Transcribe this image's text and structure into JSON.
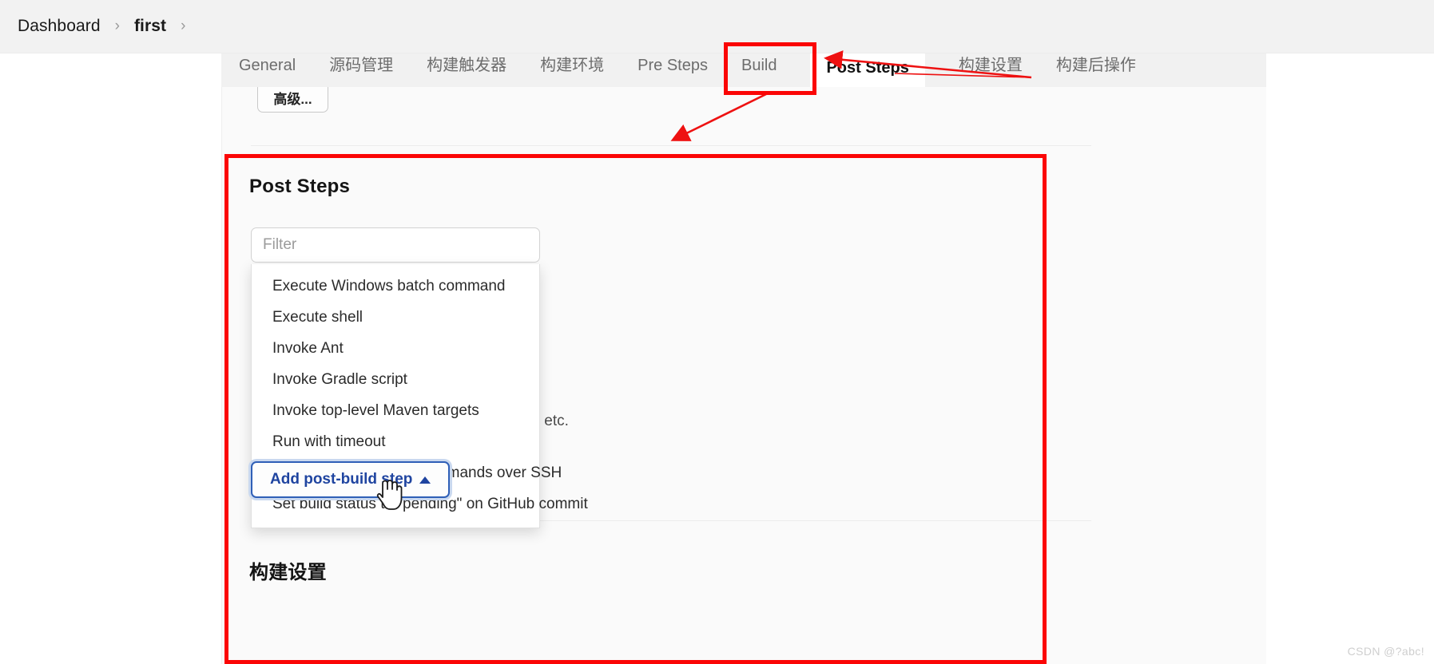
{
  "breadcrumb": {
    "items": [
      {
        "label": "Dashboard",
        "bold": false
      },
      {
        "label": "first",
        "bold": true
      }
    ],
    "separator": "›"
  },
  "tabs": [
    {
      "label": "General",
      "active": false
    },
    {
      "label": "源码管理",
      "active": false
    },
    {
      "label": "构建触发器",
      "active": false
    },
    {
      "label": "构建环境",
      "active": false
    },
    {
      "label": "Pre Steps",
      "active": false
    },
    {
      "label": "Build",
      "active": false
    },
    {
      "label": "Post Steps",
      "active": true
    },
    {
      "label": "构建设置",
      "active": false
    },
    {
      "label": "构建后操作",
      "active": false
    }
  ],
  "advanced_button": {
    "label": "高级..."
  },
  "post_steps": {
    "title": "Post Steps",
    "filter": {
      "placeholder": "Filter",
      "value": ""
    },
    "dropdown_items": [
      "Execute Windows batch command",
      "Execute shell",
      "Invoke Ant",
      "Invoke Gradle script",
      "Invoke top-level Maven targets",
      "Run with timeout",
      "Send files or execute commands over SSH",
      "Set build status to \"pending\" on GitHub commit"
    ],
    "background_description": "ul builds, etc.",
    "add_button": {
      "label": "Add post-build step",
      "caret": "caret-up-icon"
    }
  },
  "build_settings": {
    "title": "构建设置"
  },
  "watermark": "CSDN @?abc!",
  "colors": {
    "annotation_red": "#fb0505",
    "tab_active_text": "#121212",
    "tab_text": "#6d6d6d",
    "button_blue": "#1f44a0",
    "panel_bg": "#fafafa",
    "bar_bg": "#f2f2f2"
  }
}
